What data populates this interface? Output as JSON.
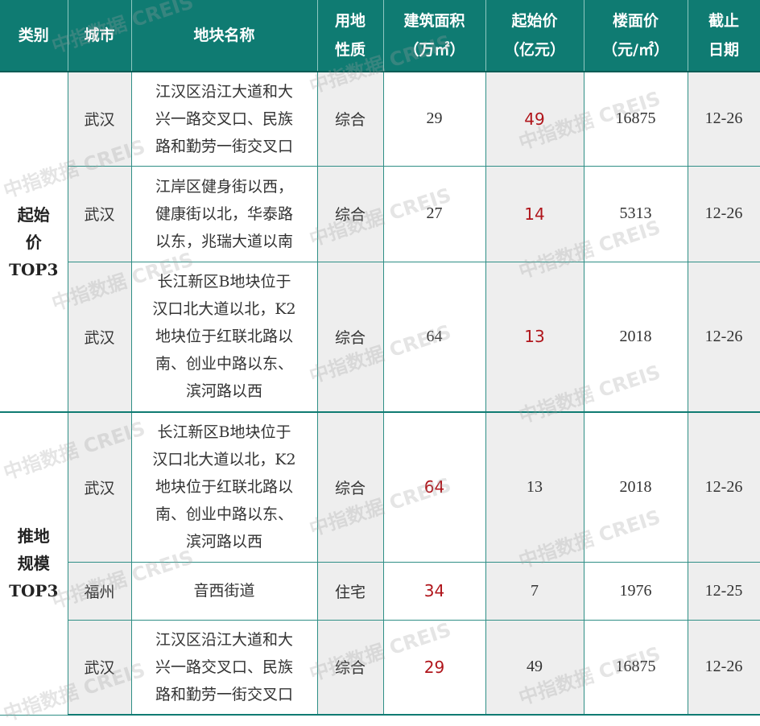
{
  "headers": {
    "category": [
      "类别"
    ],
    "city": [
      "城市"
    ],
    "parcel": [
      "地块名称"
    ],
    "usage": [
      "用地",
      "性质"
    ],
    "area": [
      "建筑面积",
      "（万㎡）"
    ],
    "start_price": [
      "起始价",
      "（亿元）"
    ],
    "floor_price": [
      "楼面价",
      "（元/㎡）"
    ],
    "deadline": [
      "截止",
      "日期"
    ]
  },
  "groups": [
    {
      "label": [
        "起始",
        "价",
        "TOP3"
      ],
      "rows": [
        {
          "city": "武汉",
          "name": [
            "江汉区沿江大道和大",
            "兴一路交叉口、民族",
            "路和勤劳一街交叉口"
          ],
          "usage": "综合",
          "area": "29",
          "start": "49",
          "floor": "16875",
          "date": "12-26"
        },
        {
          "city": "武汉",
          "name": [
            "江岸区健身街以西，",
            "健康街以北，华泰路",
            "以东，兆瑞大道以南"
          ],
          "usage": "综合",
          "area": "27",
          "start": "14",
          "floor": "5313",
          "date": "12-26"
        },
        {
          "city": "武汉",
          "name": [
            "长江新区B地块位于",
            "汉口北大道以北，K2",
            "地块位于红联北路以",
            "南、创业中路以东、",
            "滨河路以西"
          ],
          "usage": "综合",
          "area": "64",
          "start": "13",
          "floor": "2018",
          "date": "12-26"
        }
      ]
    },
    {
      "label": [
        "推地",
        "规模",
        "TOP3"
      ],
      "rows": [
        {
          "city": "武汉",
          "name": [
            "长江新区B地块位于",
            "汉口北大道以北，K2",
            "地块位于红联北路以",
            "南、创业中路以东、",
            "滨河路以西"
          ],
          "usage": "综合",
          "area": "64",
          "start": "13",
          "floor": "2018",
          "date": "12-26"
        },
        {
          "city": "福州",
          "name": [
            "音西街道"
          ],
          "usage": "住宅",
          "area": "34",
          "start": "7",
          "floor": "1976",
          "date": "12-25"
        },
        {
          "city": "武汉",
          "name": [
            "江汉区沿江大道和大",
            "兴一路交叉口、民族",
            "路和勤劳一街交叉口"
          ],
          "usage": "综合",
          "area": "29",
          "start": "49",
          "floor": "16875",
          "date": "12-26"
        }
      ]
    }
  ],
  "watermark": "中指数据 CREIS"
}
